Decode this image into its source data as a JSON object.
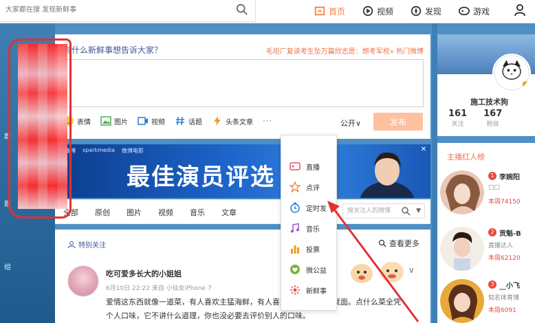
{
  "topbar": {
    "search_placeholder": "大家都在搜 发现新鲜事",
    "nav": [
      {
        "label": "首页"
      },
      {
        "label": "视频"
      },
      {
        "label": "发现"
      },
      {
        "label": "游戏"
      }
    ]
  },
  "publisher": {
    "prompt": "有什么新鲜事想告诉大家？",
    "hot_topic": "毛坦厂复读考生坠万篇欣志愿：想考军校»  热门微博",
    "tools": [
      {
        "label": "表情",
        "icon": "emoji-icon"
      },
      {
        "label": "图片",
        "icon": "image-icon"
      },
      {
        "label": "视频",
        "icon": "video-icon"
      },
      {
        "label": "话题",
        "icon": "topic-icon"
      },
      {
        "label": "头条文章",
        "icon": "article-icon"
      }
    ],
    "more": "···",
    "visibility": "公开∨",
    "send_label": "发布"
  },
  "banner": {
    "logos": [
      "微博",
      "sparkmedia",
      "微博电影"
    ],
    "title": "最佳演员评选"
  },
  "more_menu": {
    "items": [
      {
        "label": "直播",
        "icon": "live-icon"
      },
      {
        "label": "点评",
        "icon": "review-icon"
      },
      {
        "label": "定时发",
        "icon": "clock-icon"
      },
      {
        "label": "音乐",
        "icon": "music-icon"
      },
      {
        "label": "投票",
        "icon": "vote-icon"
      },
      {
        "label": "微公益",
        "icon": "charity-icon"
      },
      {
        "label": "新鲜事",
        "icon": "fresh-icon"
      }
    ]
  },
  "feed_tabs": {
    "tabs": [
      "全部",
      "原创",
      "图片",
      "视频",
      "音乐",
      "文章"
    ],
    "search_placeholder": "搜关注人的微博"
  },
  "feed": {
    "special_follow": "特别关注",
    "view_more": "查看更多",
    "post": {
      "author": "吃可爱多长大的小姐姐",
      "meta": "6月10日 22:22 来自 小仙女iPhone 7",
      "line1": "爱情这东西就像一道菜，有人喜欢主猛海鲜，有人喜欢清淡口感，这就面。点什么菜全凭",
      "line2": "个人口味，它不讲什么道理，你也没必要去评价别人的口味。"
    }
  },
  "profile": {
    "avatar_caption": "施工技术",
    "name": "施工技术狗",
    "follow_count": "161",
    "follow_label": "关注",
    "fans_count": "167",
    "fans_label": "粉丝"
  },
  "ranking": {
    "title": "主播红人榜",
    "items": [
      {
        "rank": "1",
        "name": "李婉阳",
        "desc": "□□",
        "week": "本周74150"
      },
      {
        "rank": "2",
        "name": "贡魁-B",
        "desc": "直播达人",
        "week": "本周62120"
      },
      {
        "rank": "3",
        "name": "__小飞",
        "desc": "知名体育博",
        "week": "本周6091"
      }
    ]
  },
  "left_nav": [
    "群",
    "组",
    "题"
  ],
  "colors": {
    "accent": "#fa7d3c",
    "send_disabled": "#ffc09f",
    "link": "#3b5998",
    "rank_red": "#e84a3f",
    "annotation_red": "#e23030"
  }
}
